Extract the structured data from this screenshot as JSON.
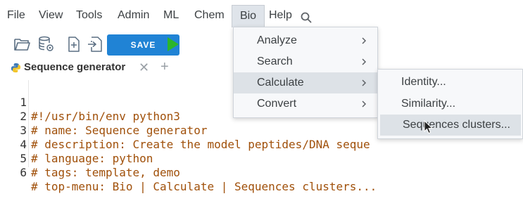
{
  "menubar": {
    "items": [
      "File",
      "View",
      "Tools",
      "Admin",
      "ML",
      "Chem",
      "Bio",
      "Help"
    ],
    "active": "Bio"
  },
  "toolbar": {
    "save_label": "SAVE",
    "icons": [
      "open-folder-icon",
      "database-settings-icon",
      "add-file-icon",
      "import-file-icon",
      "run-icon"
    ]
  },
  "tab": {
    "label": "Sequence generator",
    "icon": "python-icon"
  },
  "editor": {
    "lines": [
      {
        "num": "1",
        "text": "#!/usr/bin/env python3"
      },
      {
        "num": "2",
        "text": "# name: Sequence generator"
      },
      {
        "num": "3",
        "text": "# description: Create the model peptides/DNA seque"
      },
      {
        "num": "4",
        "text": "# language: python"
      },
      {
        "num": "5",
        "text": "# tags: template, demo"
      },
      {
        "num": "6",
        "text": "# top-menu: Bio | Calculate | Sequences clusters..."
      }
    ]
  },
  "bio_menu": {
    "items": [
      {
        "label": "Analyze",
        "submenu": true
      },
      {
        "label": "Search",
        "submenu": true
      },
      {
        "label": "Calculate",
        "submenu": true,
        "highlighted": true
      },
      {
        "label": "Convert",
        "submenu": true
      }
    ]
  },
  "calculate_menu": {
    "items": [
      {
        "label": "Identity..."
      },
      {
        "label": "Similarity..."
      },
      {
        "label": "Sequences clusters...",
        "hovered": true
      }
    ]
  },
  "colors": {
    "accent": "#2083d5",
    "run_green": "#2bb52b",
    "code": "#a0500a",
    "menu_highlight": "#dde2e7"
  }
}
